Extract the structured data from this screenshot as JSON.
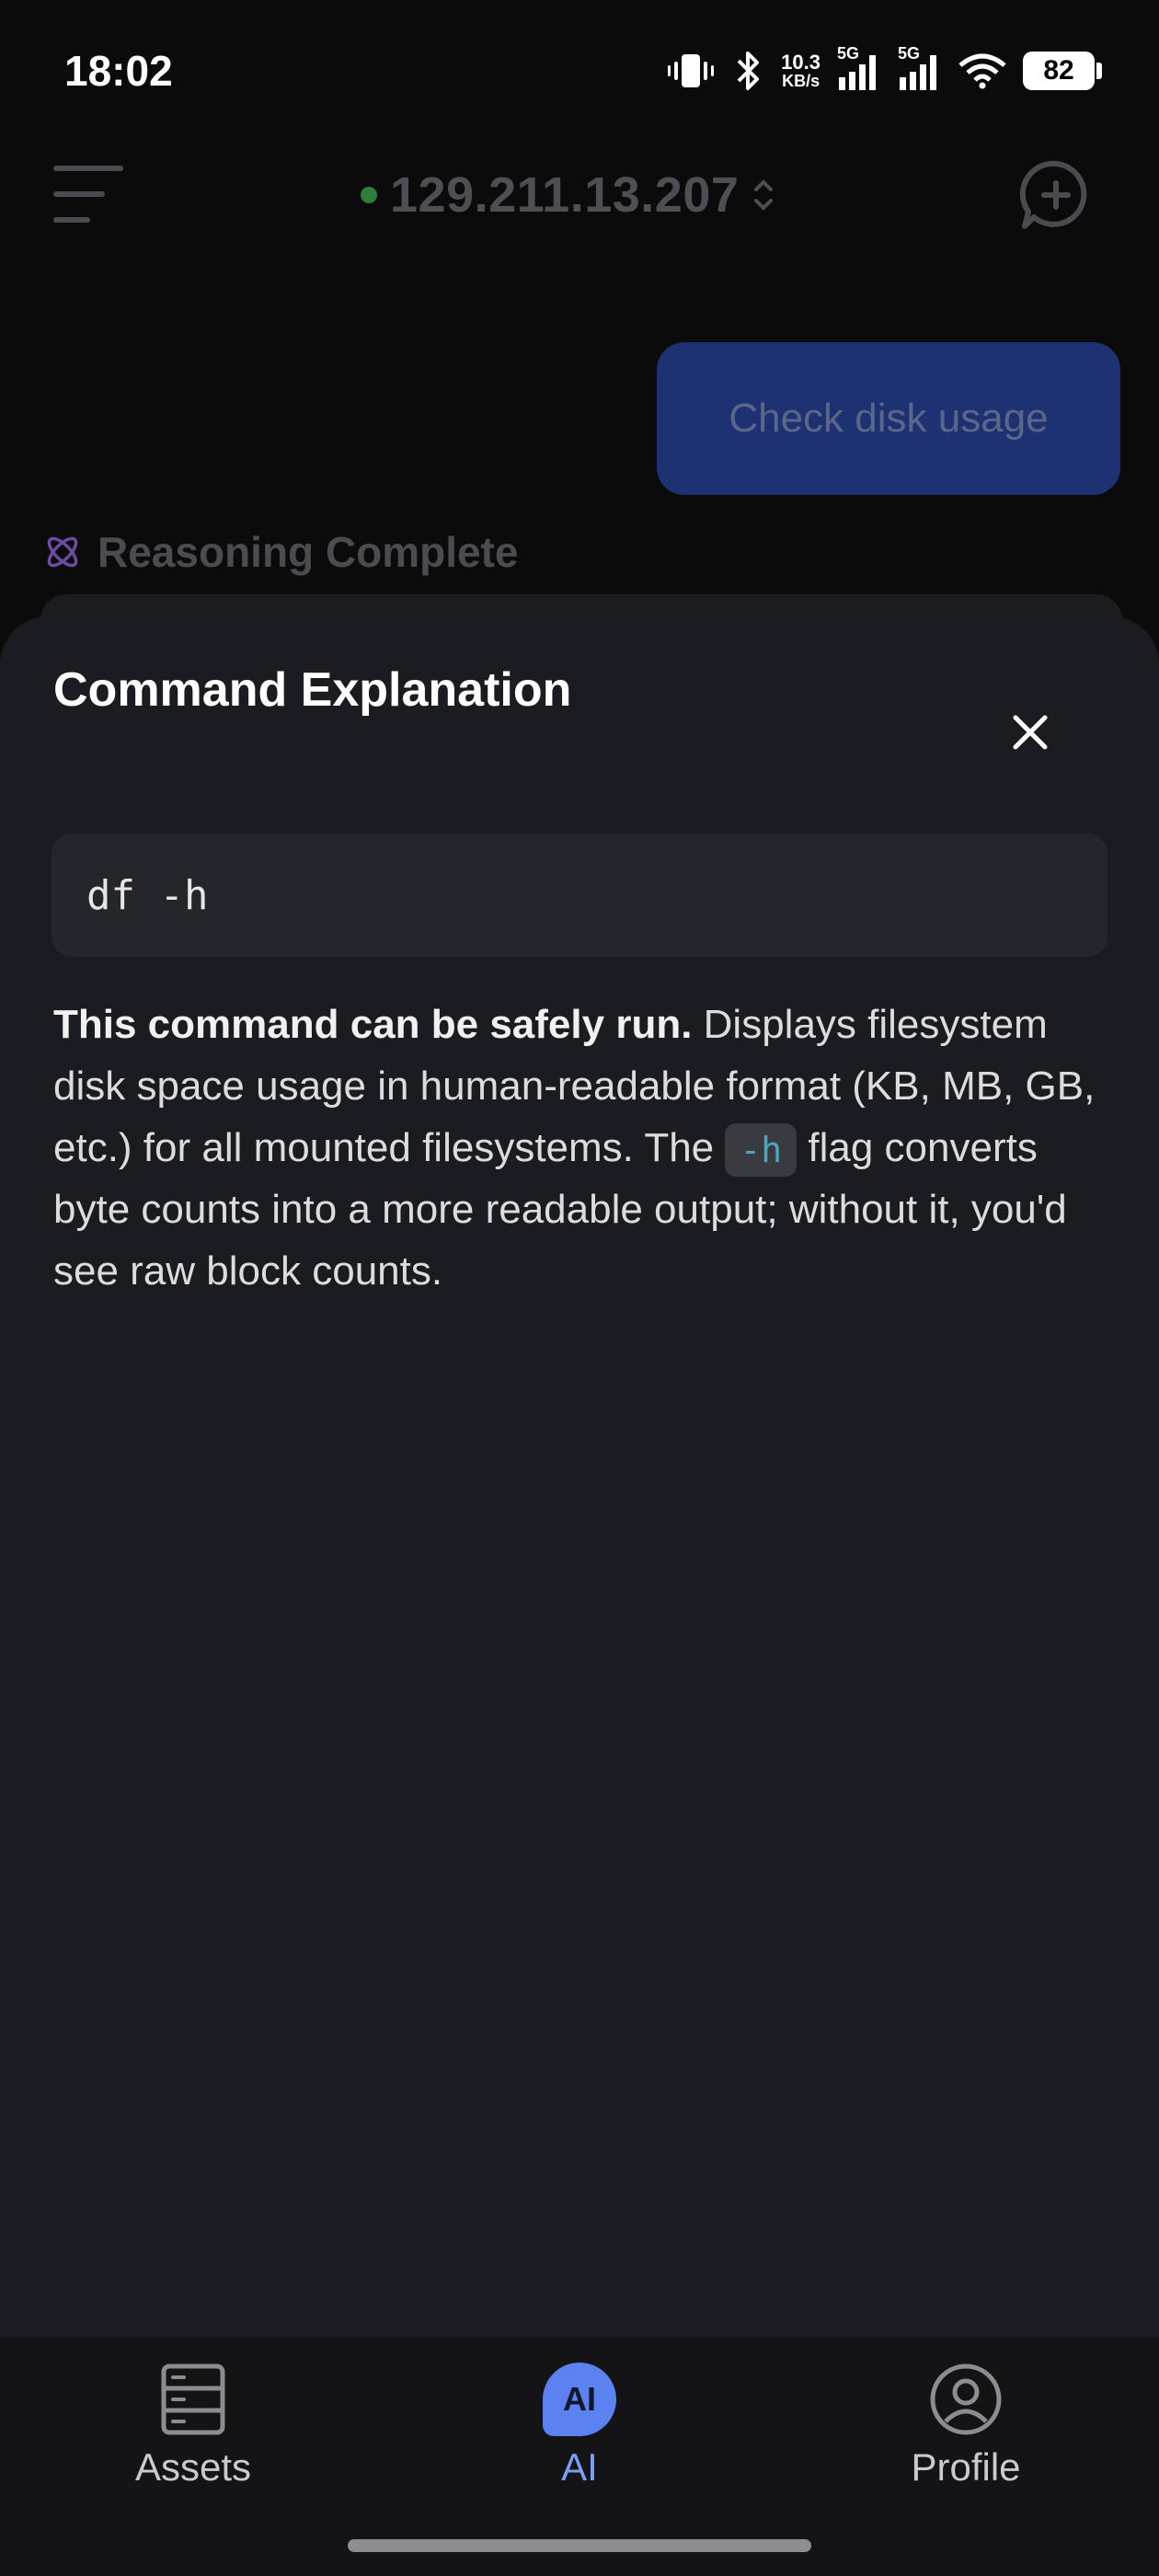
{
  "status_bar": {
    "time": "18:02",
    "net_speed_value": "10.3",
    "net_speed_unit": "KB/s",
    "sim1_tag": "5G",
    "sim2_tag": "5G",
    "battery": "82"
  },
  "header": {
    "host": "129.211.13.207",
    "host_status_color": "#2f7d3a"
  },
  "chat": {
    "user_message": "Check disk usage",
    "reasoning_label": "Reasoning Complete"
  },
  "sheet": {
    "title": "Command Explanation",
    "command": "df -h",
    "explanation_bold": "This command can be safely run.",
    "explanation_part1": " Displays filesystem disk space usage in human-readable format (KB, MB, GB, etc.) for all mounted filesystems. The ",
    "explanation_flag": "-h",
    "explanation_part2": " flag converts byte counts into a more readable output; without it, you'd see raw block counts."
  },
  "nav": {
    "assets_label": "Assets",
    "ai_label": "AI",
    "ai_icon_text": "AI",
    "profile_label": "Profile",
    "active": "AI"
  },
  "colors": {
    "accent": "#5b82f0",
    "user_bubble": "#1e3173",
    "inline_code_text": "#4aa7c4"
  }
}
